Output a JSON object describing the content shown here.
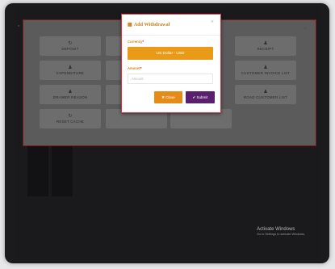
{
  "background_buttons": [
    {
      "label": "DEPOSIT",
      "icon": "deposit-icon",
      "glyph": "↻"
    },
    {
      "label": "RECEIPT",
      "icon": "receipt-icon",
      "glyph": "♟"
    },
    {
      "label": "EXPENDITURE",
      "icon": "expenditure-icon",
      "glyph": "♟"
    },
    {
      "label": "CUSTOMER INVOICE LIST",
      "icon": "invoice-icon",
      "glyph": "♟"
    },
    {
      "label": "DRAWER REASON",
      "icon": "drawer-icon",
      "glyph": "♟"
    },
    {
      "label": "ROAD CUSTOMER LIST",
      "icon": "road-customer-icon",
      "glyph": "♟"
    },
    {
      "label": "RESET CACHE",
      "icon": "reset-cache-icon",
      "glyph": "↻"
    }
  ],
  "modal": {
    "title": "Add Withdrawal",
    "close_glyph": "×",
    "currency_label": "Currency",
    "currency_value": "US Dollar - USD",
    "amount_label": "Amount",
    "amount_placeholder": "Amount",
    "close_button": "✖ Close",
    "submit_button": "✔ Submit"
  },
  "watermark": {
    "line1": "Activate Windows",
    "line2": "Go to Settings to activate Windows."
  },
  "colors": {
    "accent_orange": "#e89a18",
    "submit_purple": "#5a1f6e",
    "modal_border": "#e03040"
  }
}
